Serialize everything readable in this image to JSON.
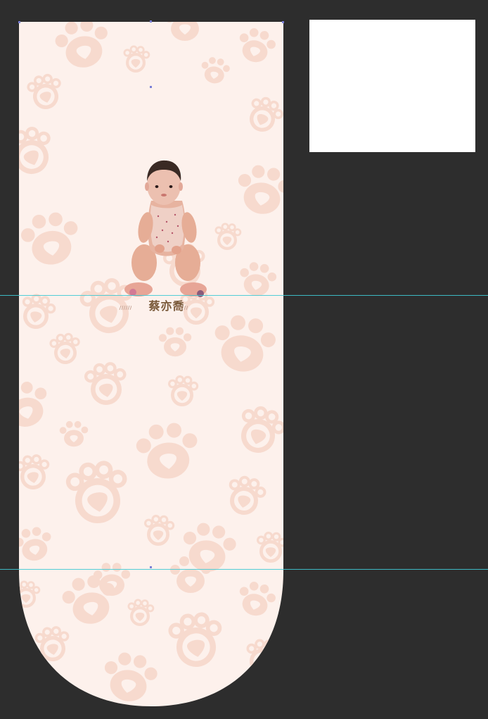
{
  "document": {
    "name_label": "蔡亦喬"
  },
  "icons": {
    "pattern": "paw-print-icon",
    "photo": "baby-photo"
  },
  "colors": {
    "workspace": "#2d2d2d",
    "artboard_bg": "#fdf1ec",
    "paw": "#f7d9cd",
    "guide": "#3fc9d4",
    "label": "#7a5a3a"
  }
}
